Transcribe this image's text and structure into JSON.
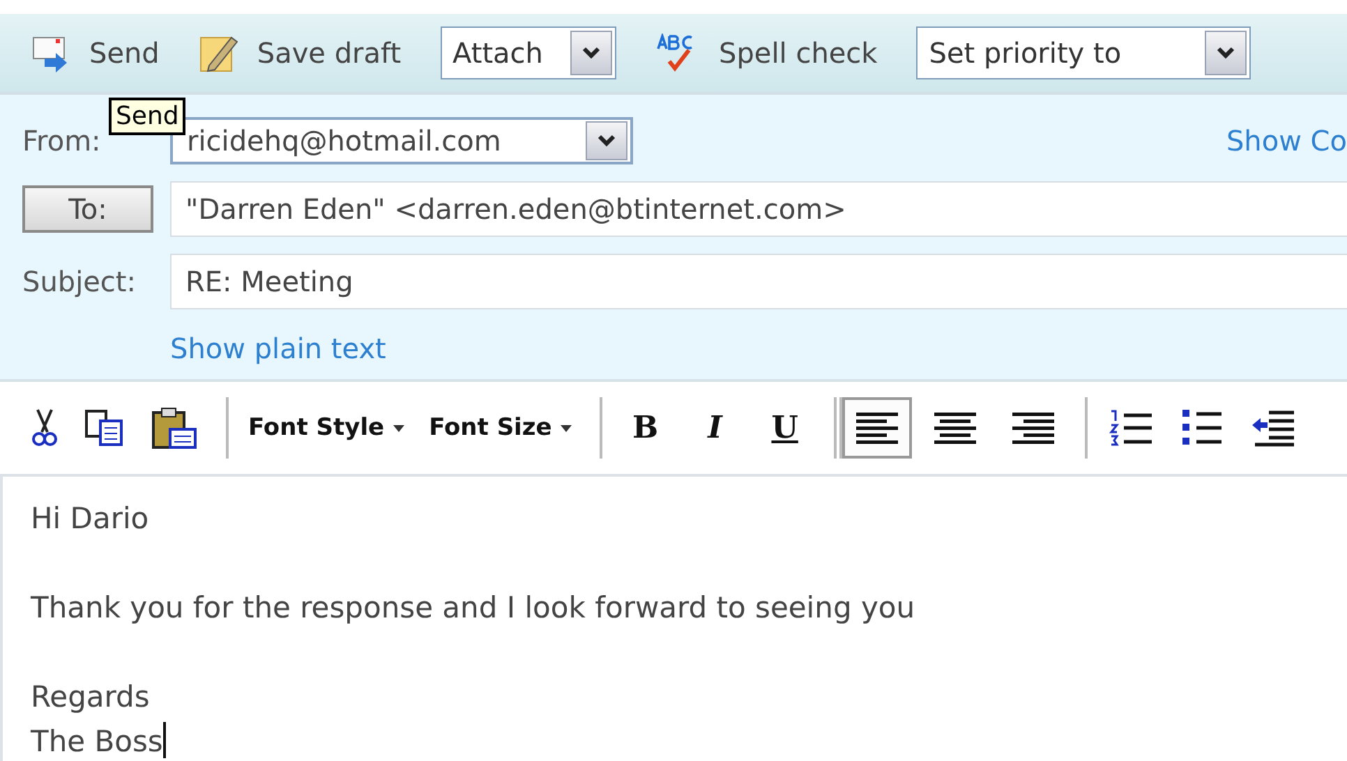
{
  "toolbar": {
    "items": [
      {
        "kind": "button",
        "label": "Send"
      },
      {
        "kind": "button",
        "label": "Save draft"
      },
      {
        "kind": "dropdown",
        "label": "Attach"
      },
      {
        "kind": "button",
        "label": "Spell check"
      },
      {
        "kind": "dropdown",
        "label": "Set priority to"
      }
    ]
  },
  "tooltip": {
    "text": "Send"
  },
  "header": {
    "from_label": "From:",
    "from_value": "ricidehq@hotmail.com",
    "show_link": "Show Co",
    "to_button": "To:",
    "to_value": "\"Darren Eden\" <darren.eden@btinternet.com>",
    "subject_label": "Subject:",
    "subject_value": "RE: Meeting",
    "plain_text_link": "Show plain text"
  },
  "format_toolbar": {
    "font_menus": [
      {
        "label": "Font Style"
      },
      {
        "label": "Font Size"
      }
    ],
    "style_buttons": [
      "B",
      "I",
      "U"
    ],
    "align_buttons": [
      {
        "selected": true
      },
      {
        "selected": false
      },
      {
        "selected": false
      }
    ]
  },
  "body": {
    "paragraphs": [
      [
        "Hi Dario"
      ],
      [
        "Thank you for the response and I look forward to seeing you"
      ],
      [
        "Regards",
        "The Boss"
      ]
    ],
    "caret": true
  }
}
